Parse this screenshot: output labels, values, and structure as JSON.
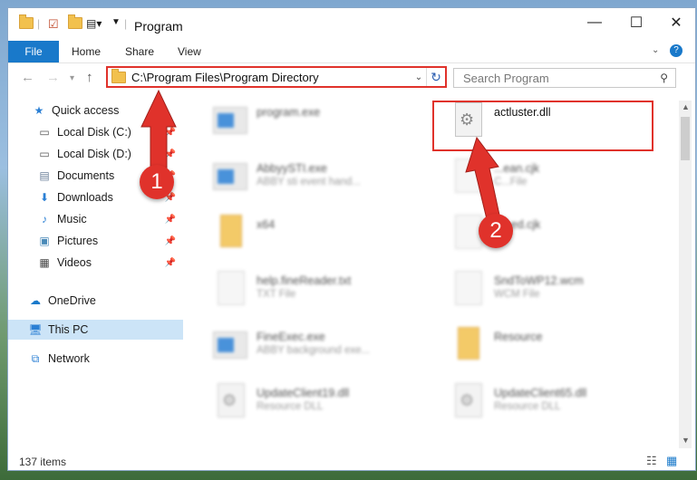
{
  "window": {
    "title": "Program"
  },
  "window_controls": {
    "minimize": "—",
    "maximize": "☐",
    "close": "✕"
  },
  "ribbon": {
    "tabs": [
      "File",
      "Home",
      "Share",
      "View"
    ]
  },
  "address": {
    "path": "C:\\Program Files\\Program Directory"
  },
  "search": {
    "placeholder": "Search Program"
  },
  "sidebar": {
    "items": [
      {
        "label": "Quick access",
        "icon": "star-icon"
      },
      {
        "label": "Local Disk (C:)",
        "icon": "drive-icon"
      },
      {
        "label": "Local Disk (D:)",
        "icon": "drive-icon"
      },
      {
        "label": "Documents",
        "icon": "documents-icon"
      },
      {
        "label": "Downloads",
        "icon": "download-icon"
      },
      {
        "label": "Music",
        "icon": "music-icon"
      },
      {
        "label": "Pictures",
        "icon": "pictures-icon"
      },
      {
        "label": "Videos",
        "icon": "videos-icon"
      },
      {
        "label": "OneDrive",
        "icon": "cloud-icon"
      },
      {
        "label": "This PC",
        "icon": "computer-icon",
        "selected": true
      },
      {
        "label": "Network",
        "icon": "network-icon"
      }
    ]
  },
  "files": [
    {
      "name": "program.exe",
      "sub": ""
    },
    {
      "name": "actluster.dll",
      "sub": ""
    },
    {
      "name": "AbbyySTI.exe",
      "sub": "ABBY sti event hand..."
    },
    {
      "name": "...ean.cjk",
      "sub": "C...File"
    },
    {
      "name": "x64",
      "sub": ""
    },
    {
      "name": "E...ed.cjk",
      "sub": ""
    },
    {
      "name": "help.fineReader.txt",
      "sub": "TXT File"
    },
    {
      "name": "SndToWP12.wcm",
      "sub": "WCM File"
    },
    {
      "name": "FineExec.exe",
      "sub": "ABBY background exe..."
    },
    {
      "name": "Resource",
      "sub": ""
    },
    {
      "name": "UpdateClient19.dll",
      "sub": "Resource DLL"
    },
    {
      "name": "UpdateClient65.dll",
      "sub": "Resource DLL"
    }
  ],
  "status": {
    "items": "137 items"
  },
  "callouts": {
    "one": "1",
    "two": "2"
  },
  "colors": {
    "accent": "#1979ca",
    "highlight": "#e0322b"
  }
}
